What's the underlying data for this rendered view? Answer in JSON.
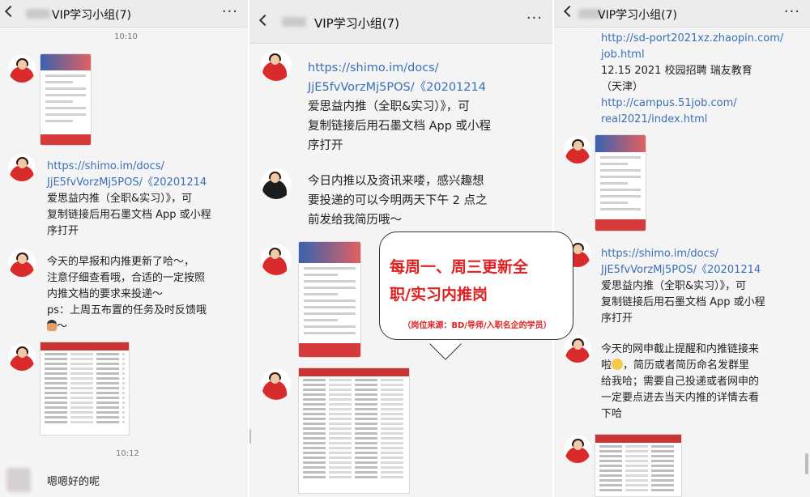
{
  "panels": [
    {
      "title": "VIP学习小组(7)",
      "time_top": "10:10",
      "link_msg": [
        "https://shimo.im/docs/",
        "JjE5fvVorzMj5POS/",
        "《20201214",
        "爱思益内推（全职&实习）》，可",
        "复制链接后用石墨文档 App 或小程",
        "序打开"
      ],
      "text_msg": [
        "今天的早报和内推更新了哈～，",
        "注意仔细查看哦，合适的一定按照",
        "内推文档的要求来投递～",
        "ps：上周五布置的任务及时反馈哦",
        "～"
      ],
      "time_bottom": "10:12",
      "reply": "嗯嗯好的呢"
    },
    {
      "title": "VIP学习小组(7)",
      "link_msg": [
        "https://shimo.im/docs/",
        "JjE5fvVorzMj5POS/",
        "《20201214",
        "爱思益内推（全职&实习）》，可",
        "复制链接后用石墨文档 App 或小程",
        "序打开"
      ],
      "text_msg": [
        "今日内推以及资讯来喽，感兴趣想",
        "要投递的可以今明两天下午 2 点之",
        "前发给我简历哦～"
      ]
    },
    {
      "title": "VIP学习小组(7)",
      "top_msg": [
        "http://sd-port2021xz.zhaopin.com/",
        "job.html",
        "12.15    2021 校园招聘    瑞友教育",
        "（天津）",
        "http://campus.51job.com/",
        "real2021/index.html"
      ],
      "link_msg": [
        "https://shimo.im/docs/",
        "JjE5fvVorzMj5POS/",
        "《20201214",
        "爱思益内推（全职&实习）》，可",
        "复制链接后用石墨文档 App 或小程",
        "序打开"
      ],
      "text_msg": [
        "今天的网申截止提醒和内推链接来",
        "啦",
        "，简历或者简历命名发群里",
        "给我哈；需要自己投递或者网申的",
        "一定要点进去当天内推的详情去看",
        "下哈"
      ]
    }
  ],
  "callout": {
    "line1": "每周一、周三更新全",
    "line2": "职/实习内推岗",
    "note": "（岗位来源：BD/导师/入职名企的学员）"
  },
  "more_label": "···"
}
